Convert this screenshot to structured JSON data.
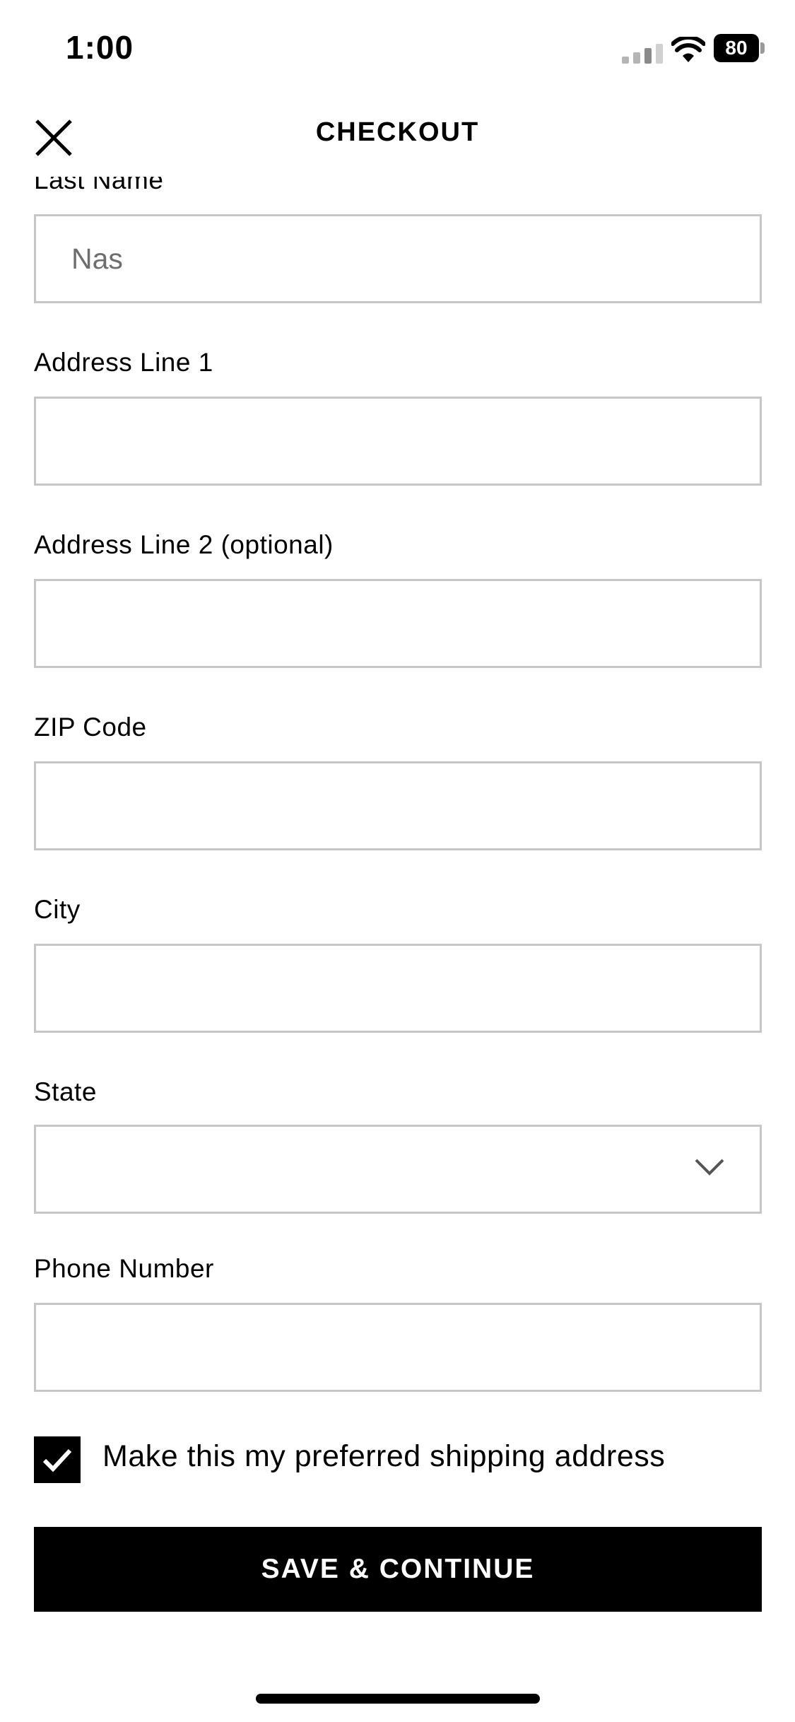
{
  "status_bar": {
    "time": "1:00",
    "battery_level": "80",
    "icons": [
      "signal-icon",
      "wifi-icon",
      "battery-icon"
    ]
  },
  "nav": {
    "title": "CHECKOUT",
    "close_icon": "close-icon"
  },
  "form": {
    "last_name": {
      "label": "Last Name",
      "value": "Nas"
    },
    "address_line_1": {
      "label": "Address Line 1",
      "value": ""
    },
    "address_line_2": {
      "label": "Address Line 2 (optional)",
      "value": ""
    },
    "zip_code": {
      "label": "ZIP Code",
      "value": ""
    },
    "city": {
      "label": "City",
      "value": ""
    },
    "state": {
      "label": "State",
      "value": "",
      "icon": "chevron-down-icon"
    },
    "phone_number": {
      "label": "Phone Number",
      "value": ""
    },
    "preferred_address": {
      "label": "Make this my preferred shipping address",
      "checked": true
    }
  },
  "actions": {
    "save_label": "SAVE & CONTINUE"
  },
  "colors": {
    "accent": "#000000",
    "border": "#c6c6c6",
    "value_text": "#6e6e6e"
  }
}
